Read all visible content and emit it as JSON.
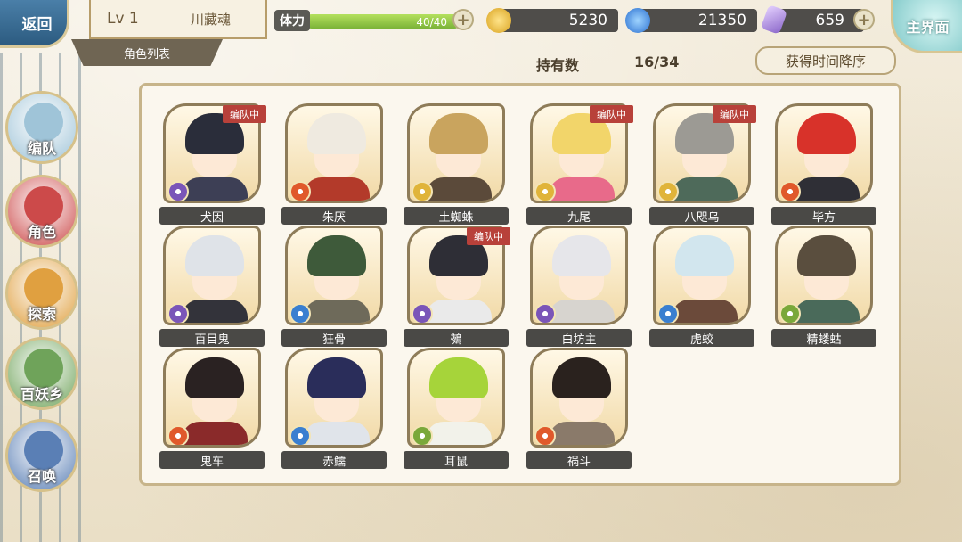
{
  "header": {
    "back_label": "返回",
    "level": "Lv 1",
    "player_name": "川藏魂",
    "section_title": "角色列表",
    "stamina_label": "体力",
    "stamina_value": "40/40",
    "stamina_fraction": 1.0,
    "coins": "5230",
    "spirit": "21350",
    "gems": "659",
    "main_label": "主界面",
    "owned_label": "持有数",
    "owned_value": "16/34",
    "sort_label": "获得时间降序"
  },
  "nav": [
    {
      "label": "编队",
      "icon": "team-icon",
      "color": "#9fc4d8"
    },
    {
      "label": "角色",
      "icon": "character-icon",
      "color": "#cc4a4a"
    },
    {
      "label": "探索",
      "icon": "explore-icon",
      "color": "#e0a040"
    },
    {
      "label": "百妖乡",
      "icon": "village-icon",
      "color": "#6fa35a"
    },
    {
      "label": "召唤",
      "icon": "summon-icon",
      "color": "#5a7fb5"
    }
  ],
  "colors": {
    "fire": "#e0592b",
    "water": "#3a7fd0",
    "void": "#7a55b8",
    "light": "#e0b43a",
    "wind": "#7aa83a"
  },
  "characters": [
    {
      "name": "犬因",
      "badge": "编队中",
      "element": "void",
      "hair": "#2a2d3a",
      "body": "#3d3f55"
    },
    {
      "name": "朱厌",
      "badge": "",
      "element": "fire",
      "hair": "#efeae0",
      "body": "#b33a2a"
    },
    {
      "name": "土蜘蛛",
      "badge": "",
      "element": "light",
      "hair": "#c9a45e",
      "body": "#5b4a3a"
    },
    {
      "name": "九尾",
      "badge": "编队中",
      "element": "light",
      "hair": "#f2d56a",
      "body": "#e86a8a"
    },
    {
      "name": "八咫乌",
      "badge": "编队中",
      "element": "light",
      "hair": "#9c9a94",
      "body": "#4e6a5a"
    },
    {
      "name": "毕方",
      "badge": "",
      "element": "fire",
      "hair": "#d8322a",
      "body": "#2f2f36"
    },
    {
      "name": "百目鬼",
      "badge": "",
      "element": "void",
      "hair": "#dfe3e8",
      "body": "#33333a"
    },
    {
      "name": "狂骨",
      "badge": "",
      "element": "water",
      "hair": "#3e5a3a",
      "body": "#6e6a5a"
    },
    {
      "name": "鵺",
      "badge": "编队中",
      "element": "void",
      "hair": "#2e2e36",
      "body": "#eaeaea"
    },
    {
      "name": "白坊主",
      "badge": "",
      "element": "void",
      "hair": "#e6e6ea",
      "body": "#d7d4cf"
    },
    {
      "name": "虎蛟",
      "badge": "",
      "element": "water",
      "hair": "#d2e6ee",
      "body": "#6b4a3a"
    },
    {
      "name": "精蝼蛄",
      "badge": "",
      "element": "wind",
      "hair": "#5a4e3e",
      "body": "#4a6a5a"
    },
    {
      "name": "鬼车",
      "badge": "",
      "element": "fire",
      "hair": "#2a2222",
      "body": "#8a2a2a"
    },
    {
      "name": "赤鱬",
      "badge": "",
      "element": "water",
      "hair": "#2a2d5a",
      "body": "#e0e4ea"
    },
    {
      "name": "耳鼠",
      "badge": "",
      "element": "wind",
      "hair": "#a6d43a",
      "body": "#f2f2ea"
    },
    {
      "name": "祸斗",
      "badge": "",
      "element": "fire",
      "hair": "#2a221e",
      "body": "#8a7a6a"
    }
  ]
}
